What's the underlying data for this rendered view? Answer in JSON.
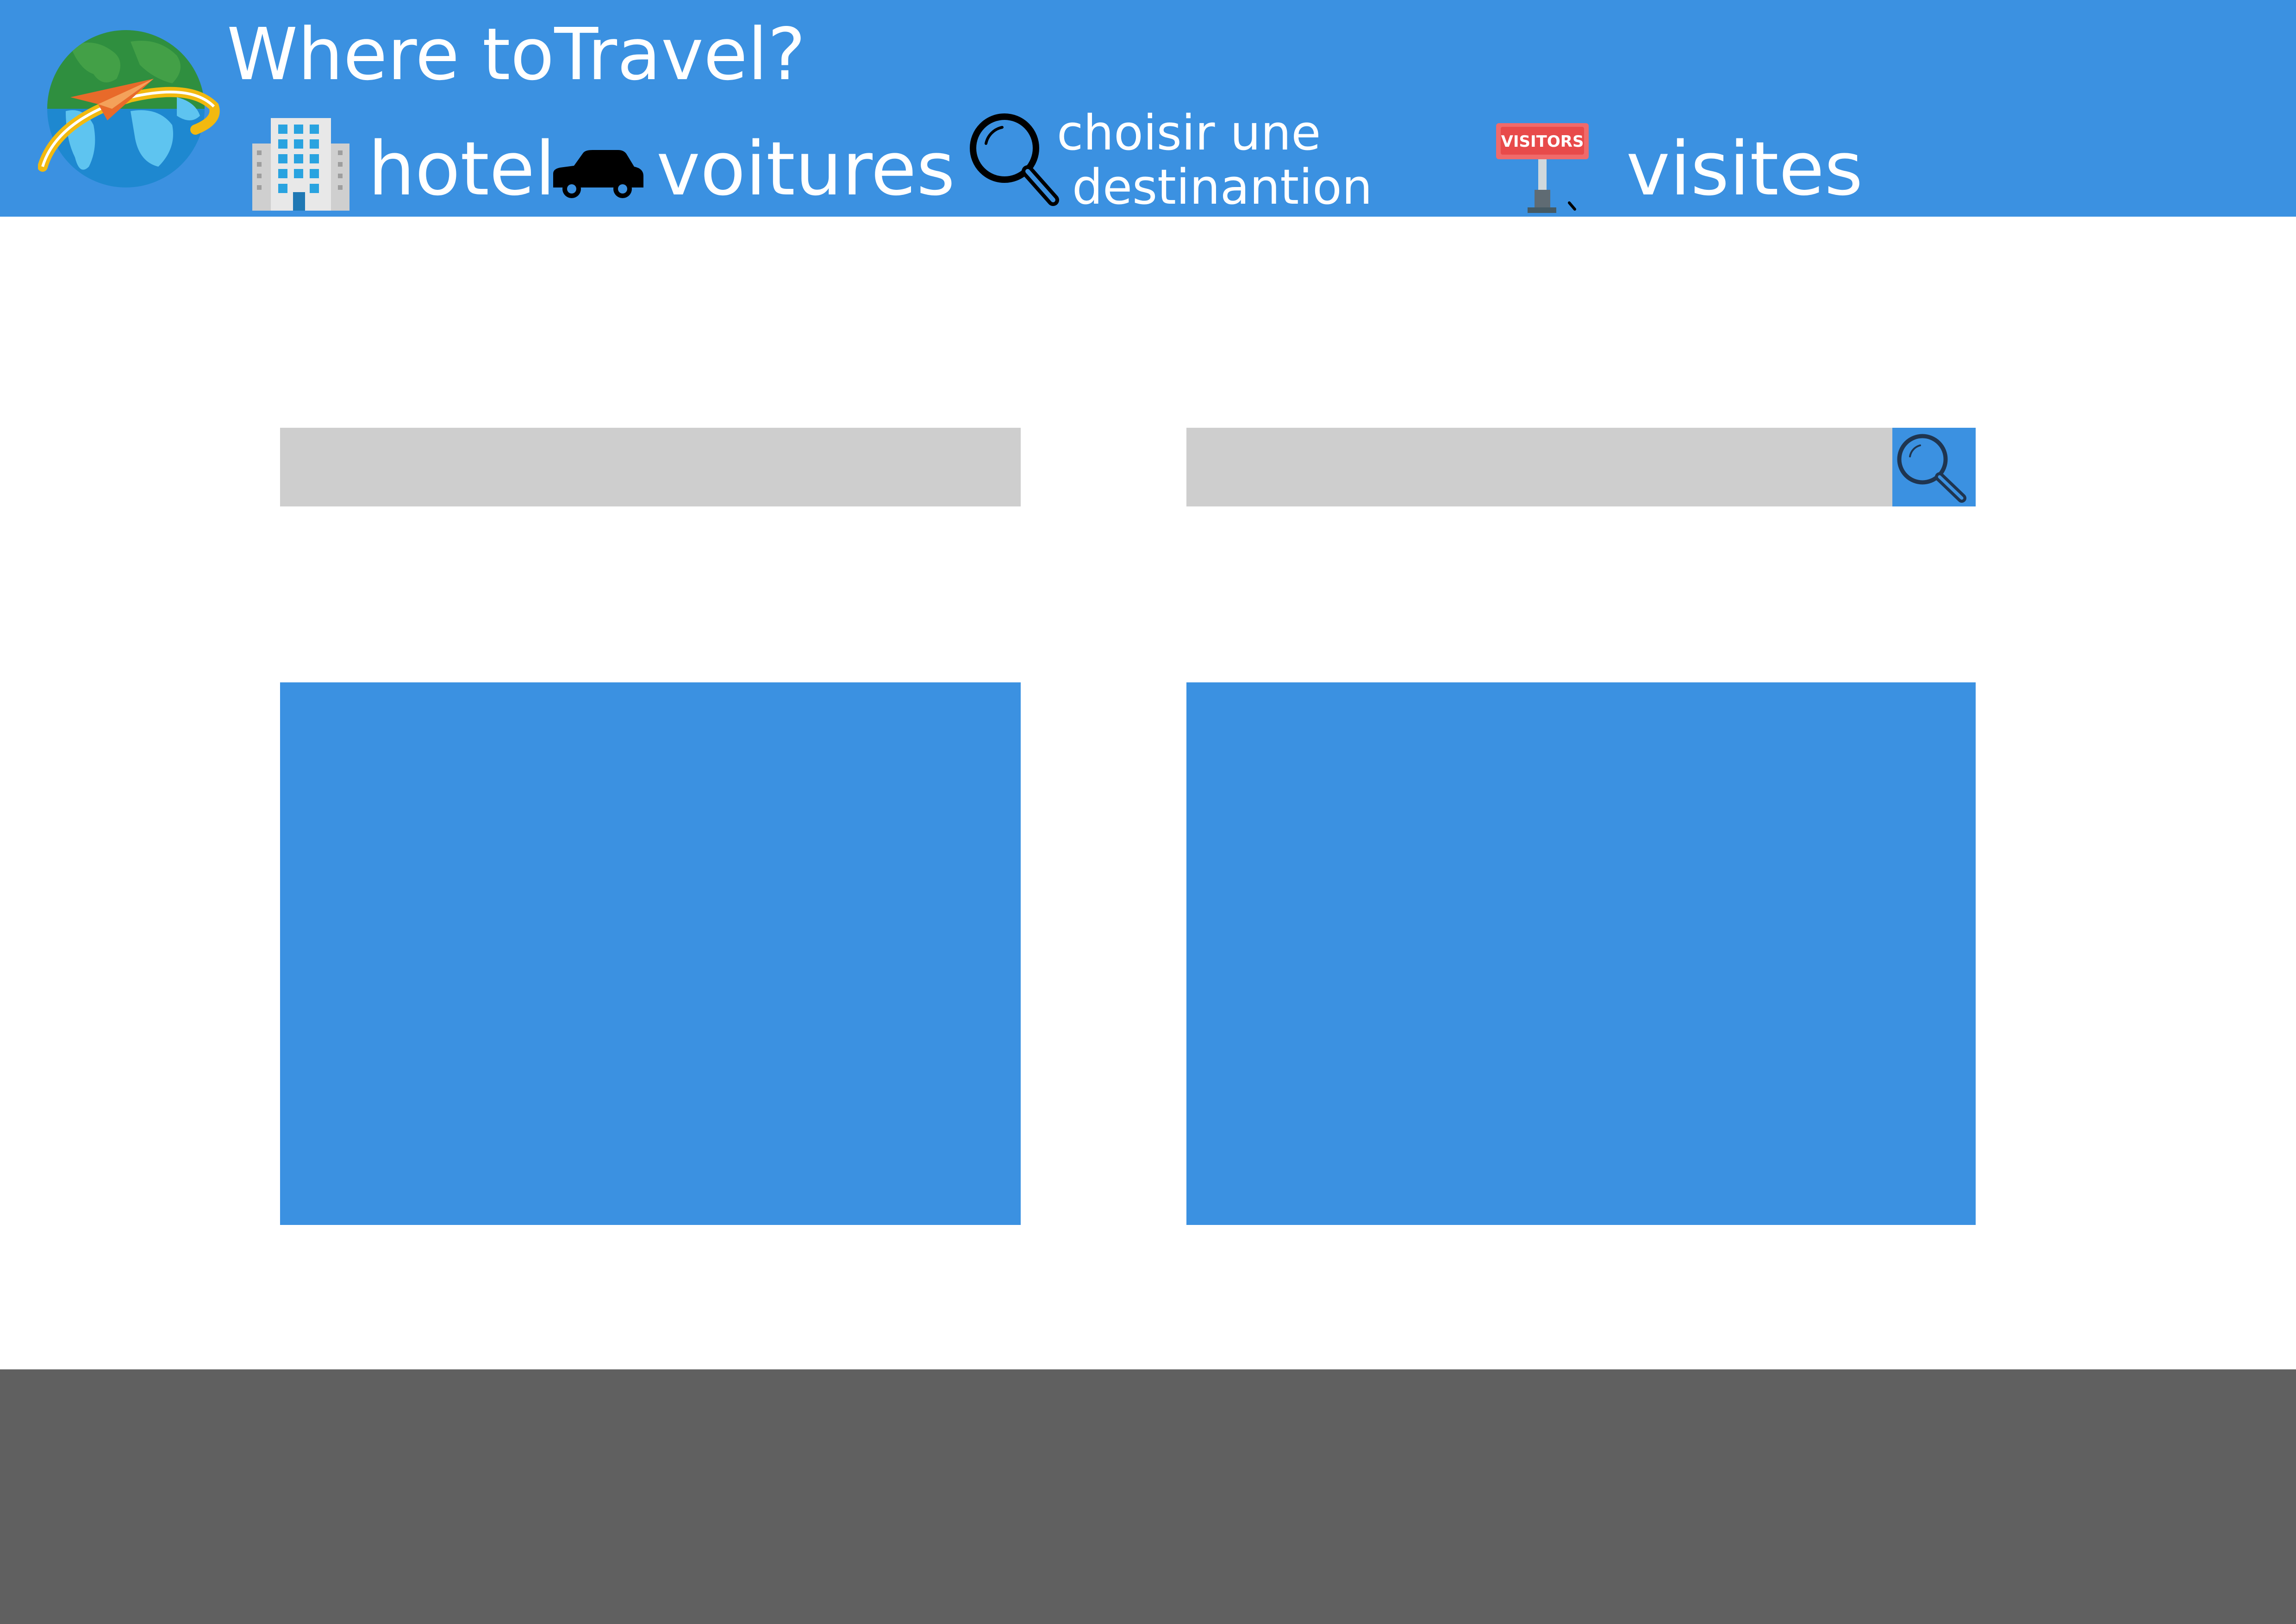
{
  "header": {
    "title": "Where toTravel?",
    "logo_icon": "globe-airplane-icon",
    "background": "#3b91e1"
  },
  "nav": {
    "hotel": {
      "label": "hotel",
      "icon": "hotel-building-icon"
    },
    "voitures": {
      "label": "voitures",
      "icon": "car-icon"
    },
    "destination": {
      "line1": "choisir une",
      "line2": "destinantion",
      "icon": "magnifier-icon"
    },
    "visites": {
      "label": "visites",
      "icon": "visitors-sign-icon"
    }
  },
  "search": {
    "left_field": {
      "value": "",
      "placeholder": ""
    },
    "right_field": {
      "value": "",
      "placeholder": ""
    },
    "button_icon": "search-icon"
  },
  "colors": {
    "accent": "#3b91e1",
    "field": "#cecece",
    "footer": "#606060"
  }
}
